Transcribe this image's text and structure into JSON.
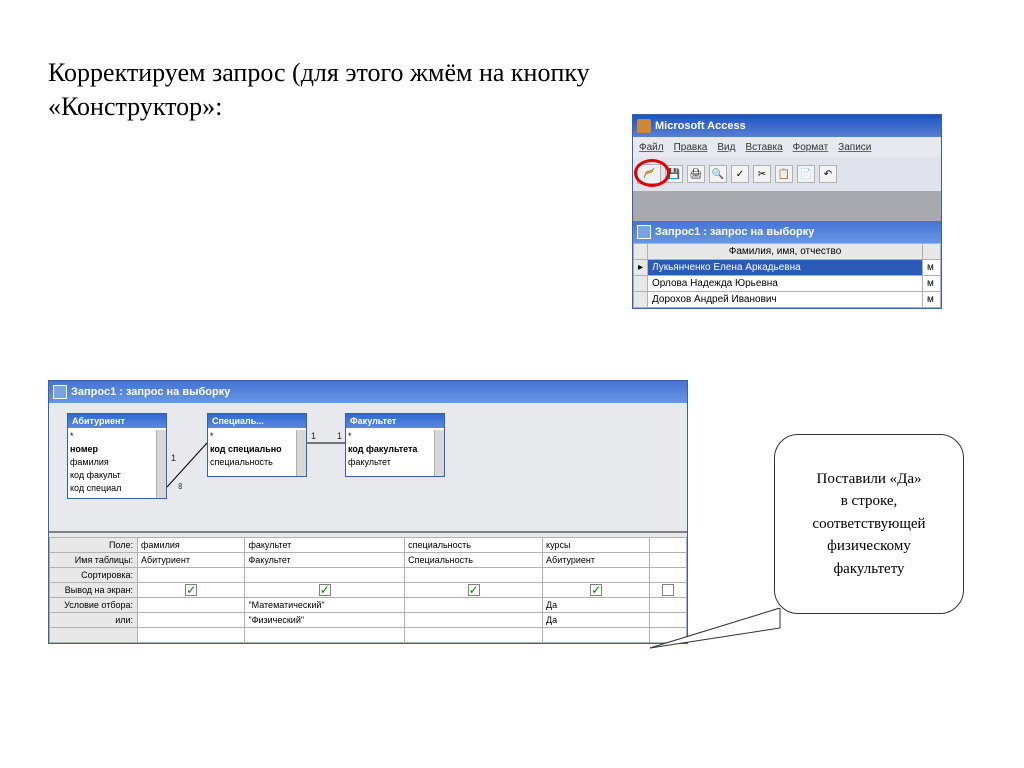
{
  "slide": {
    "title": "Корректируем запрос (для этого жмём на кнопку «Конструктор»:"
  },
  "access": {
    "app_title": "Microsoft Access",
    "menu": [
      "Файл",
      "Правка",
      "Вид",
      "Вставка",
      "Формат",
      "Записи"
    ],
    "query_window_title": "Запрос1 : запрос на выборку",
    "datasheet_header": "Фамилия, имя, отчество",
    "rows": [
      "Лукьянченко Елена Аркадьевна",
      "Орлова Надежда Юрьевна",
      "Дорохов Андрей Иванович"
    ]
  },
  "designer": {
    "title": "Запрос1 : запрос на выборку",
    "tables": [
      {
        "title": "Абитуриент",
        "fields": [
          "*",
          "номер",
          "фамилия",
          "код факульт",
          "код специал"
        ]
      },
      {
        "title": "Специаль...",
        "fields": [
          "*",
          "код специально",
          "специальность"
        ]
      },
      {
        "title": "Факультет",
        "fields": [
          "*",
          "код факультета",
          "факультет"
        ]
      }
    ],
    "grid_labels": {
      "field": "Поле:",
      "table": "Имя таблицы:",
      "sort": "Сортировка:",
      "show": "Вывод на экран:",
      "cond": "Условие отбора:",
      "or": "или:"
    },
    "cols": [
      {
        "field": "фамилия",
        "table": "Абитуриент",
        "cond": "",
        "or": ""
      },
      {
        "field": "факультет",
        "table": "Факультет",
        "cond": "\"Математический\"",
        "or": "\"Физический\""
      },
      {
        "field": "специальность",
        "table": "Специальность",
        "cond": "",
        "or": ""
      },
      {
        "field": "курсы",
        "table": "Абитуриент",
        "cond": "Да",
        "or": "Да"
      }
    ]
  },
  "callout": {
    "text": "Поставили «Да»\nв строке, соответствующей физическому факультету"
  }
}
